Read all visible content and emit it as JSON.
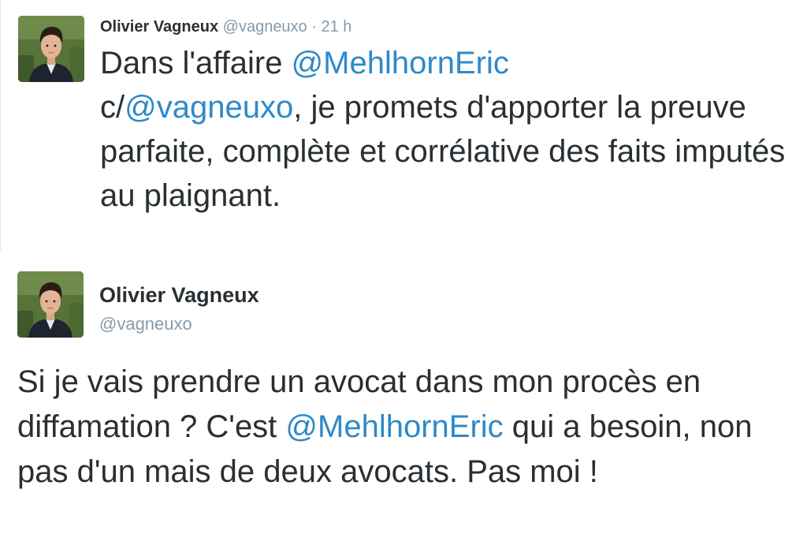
{
  "tweets": [
    {
      "author_name": "Olivier Vagneux",
      "author_handle": "@vagneuxo",
      "separator": "·",
      "time": "21 h",
      "text_parts": [
        "Dans l'affaire ",
        "@MehlhornEric",
        " c/",
        "@vagneuxo",
        ", je promets d'apporter la preuve parfaite, complète et corrélative des faits imputés au plaignant."
      ]
    },
    {
      "author_name": "Olivier Vagneux",
      "author_handle": "@vagneuxo",
      "text_parts": [
        "Si je vais prendre un avocat dans mon procès en diffamation ? C'est ",
        "@MehlhornEric",
        " qui a besoin, non pas d'un mais de deux avocats. Pas moi !"
      ]
    }
  ],
  "colors": {
    "mention": "#2f89c9",
    "text": "#292f33",
    "muted": "#8899a6"
  },
  "icons": {
    "avatar": "profile-photo"
  }
}
